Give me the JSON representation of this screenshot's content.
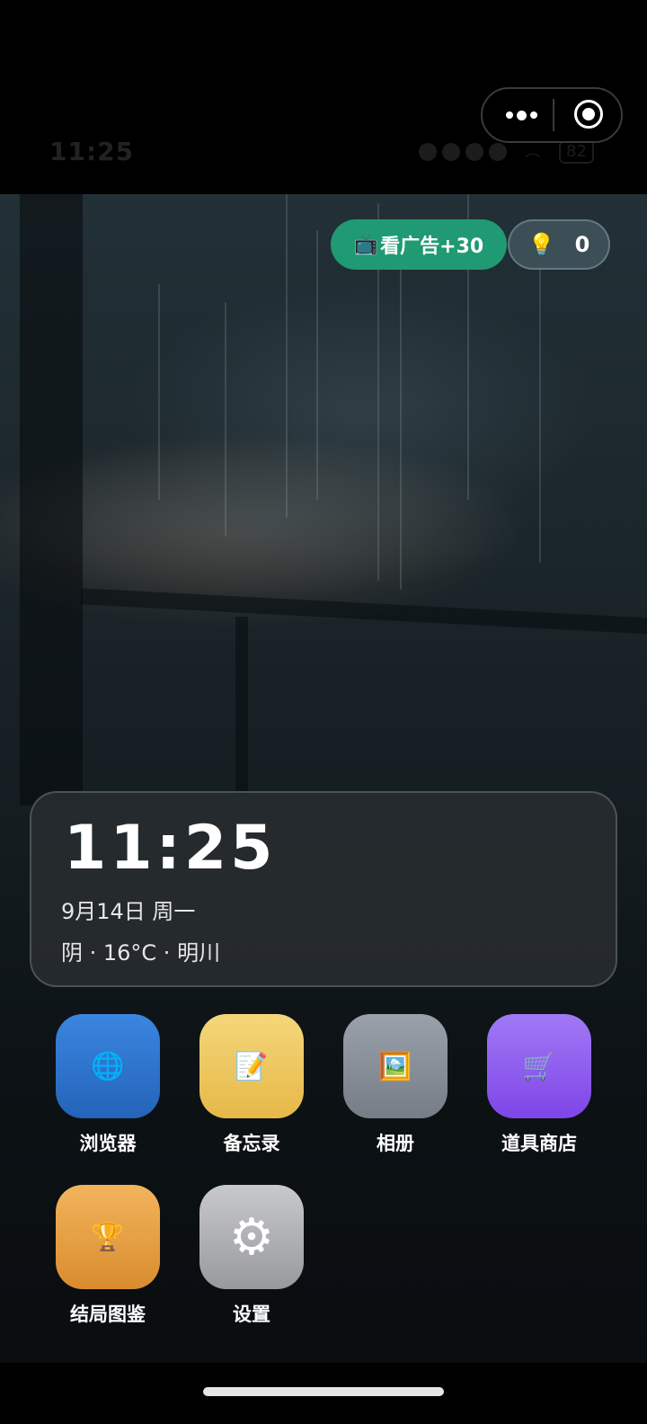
{
  "status_bar": {
    "time": "11:25",
    "battery": "82"
  },
  "capsule": {
    "more_icon": "more-dots-icon",
    "close_icon": "target-icon"
  },
  "top_actions": {
    "ad_icon": "📺",
    "ad_label": "看广告+30",
    "coin_icon": "💡",
    "coin_count": "0"
  },
  "widget": {
    "time": "11:25",
    "date": "9月14日 周一",
    "weather": "阴 · 16°C · 明川"
  },
  "apps": [
    {
      "label": "浏览器",
      "icon": "🌐",
      "icon_name": "globe-icon",
      "color": "#2f78d0"
    },
    {
      "label": "备忘录",
      "icon": "📝",
      "icon_name": "memo-icon",
      "color": "#efc860"
    },
    {
      "label": "相册",
      "icon": "🖼️",
      "icon_name": "picture-icon",
      "color": "#868d97"
    },
    {
      "label": "道具商店",
      "icon": "🛒",
      "icon_name": "cart-icon",
      "color": "#8f5ff0"
    },
    {
      "label": "结局图鉴",
      "icon": "🏆",
      "icon_name": "trophy-icon",
      "color": "#e6a046"
    },
    {
      "label": "设置",
      "icon": "⚙",
      "icon_name": "gear-icon",
      "color": "#b2b3b6"
    }
  ],
  "colors": {
    "ad_button": "#1f9a72",
    "background": "#000000"
  }
}
